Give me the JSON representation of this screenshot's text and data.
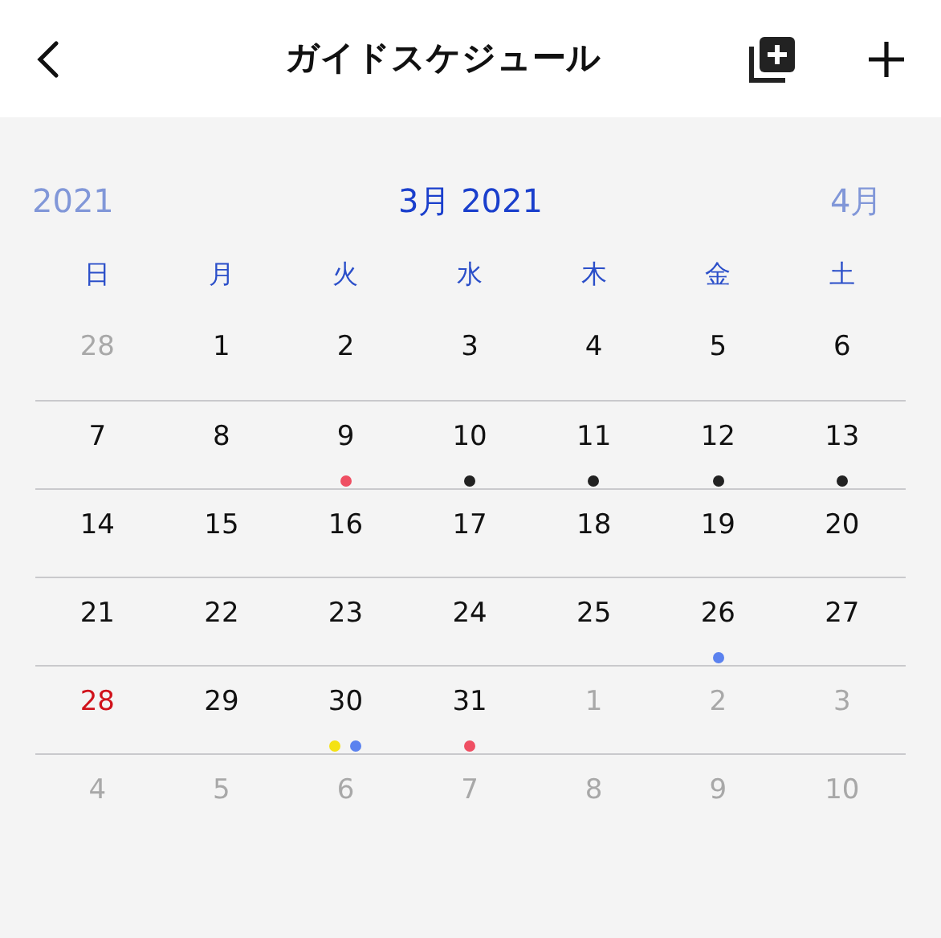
{
  "header": {
    "title": "ガイドスケジュール"
  },
  "month_nav": {
    "previous": "2021",
    "current": "3月 2021",
    "next": "4月"
  },
  "weekdays": [
    "日",
    "月",
    "火",
    "水",
    "木",
    "金",
    "土"
  ],
  "weeks": [
    [
      {
        "day": "28",
        "kind": "outside"
      },
      {
        "day": "1",
        "kind": "in-month"
      },
      {
        "day": "2",
        "kind": "in-month"
      },
      {
        "day": "3",
        "kind": "in-month"
      },
      {
        "day": "4",
        "kind": "in-month"
      },
      {
        "day": "5",
        "kind": "in-month"
      },
      {
        "day": "6",
        "kind": "in-month"
      }
    ],
    [
      {
        "day": "7",
        "kind": "in-month"
      },
      {
        "day": "8",
        "kind": "in-month"
      },
      {
        "day": "9",
        "kind": "in-month",
        "dots": [
          {
            "color": "#ef4f63"
          }
        ]
      },
      {
        "day": "10",
        "kind": "in-month",
        "dots": [
          {
            "color": "#222222"
          }
        ]
      },
      {
        "day": "11",
        "kind": "in-month",
        "dots": [
          {
            "color": "#222222"
          }
        ]
      },
      {
        "day": "12",
        "kind": "in-month",
        "dots": [
          {
            "color": "#222222"
          }
        ]
      },
      {
        "day": "13",
        "kind": "in-month",
        "dots": [
          {
            "color": "#222222"
          }
        ]
      }
    ],
    [
      {
        "day": "14",
        "kind": "in-month"
      },
      {
        "day": "15",
        "kind": "in-month"
      },
      {
        "day": "16",
        "kind": "in-month"
      },
      {
        "day": "17",
        "kind": "in-month"
      },
      {
        "day": "18",
        "kind": "in-month"
      },
      {
        "day": "19",
        "kind": "in-month"
      },
      {
        "day": "20",
        "kind": "in-month"
      }
    ],
    [
      {
        "day": "21",
        "kind": "in-month"
      },
      {
        "day": "22",
        "kind": "in-month"
      },
      {
        "day": "23",
        "kind": "in-month"
      },
      {
        "day": "24",
        "kind": "in-month"
      },
      {
        "day": "25",
        "kind": "in-month"
      },
      {
        "day": "26",
        "kind": "in-month",
        "dots": [
          {
            "color": "#5b82ef"
          }
        ]
      },
      {
        "day": "27",
        "kind": "in-month"
      }
    ],
    [
      {
        "day": "28",
        "kind": "today"
      },
      {
        "day": "29",
        "kind": "in-month"
      },
      {
        "day": "30",
        "kind": "in-month",
        "dots": [
          {
            "color": "#f4e214"
          },
          {
            "color": "#5b82ef"
          }
        ]
      },
      {
        "day": "31",
        "kind": "in-month",
        "dots": [
          {
            "color": "#ef4f63"
          }
        ]
      },
      {
        "day": "1",
        "kind": "outside"
      },
      {
        "day": "2",
        "kind": "outside"
      },
      {
        "day": "3",
        "kind": "outside"
      }
    ],
    [
      {
        "day": "4",
        "kind": "outside"
      },
      {
        "day": "5",
        "kind": "outside"
      },
      {
        "day": "6",
        "kind": "outside"
      },
      {
        "day": "7",
        "kind": "outside"
      },
      {
        "day": "8",
        "kind": "outside"
      },
      {
        "day": "9",
        "kind": "outside"
      },
      {
        "day": "10",
        "kind": "outside"
      }
    ]
  ]
}
